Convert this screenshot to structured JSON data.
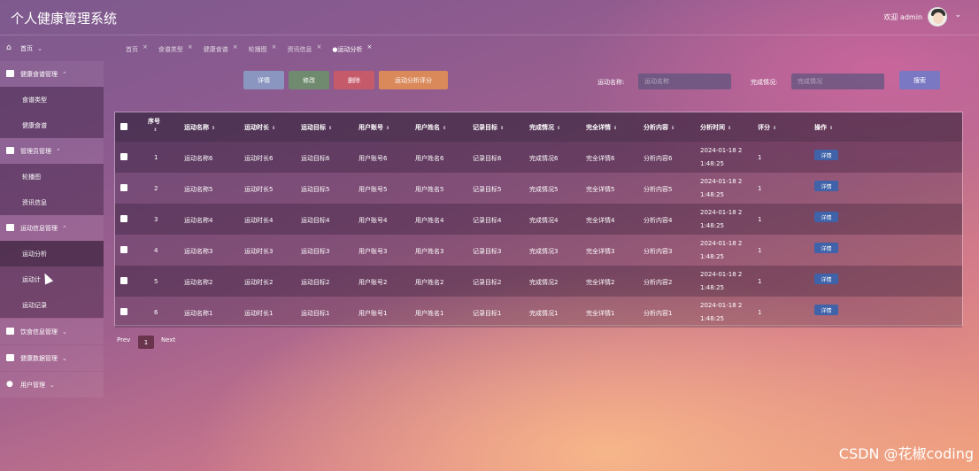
{
  "header": {
    "title": "个人健康管理系统",
    "welcome": "欢迎 admin"
  },
  "sidebar": {
    "home": "首页",
    "group1": "健康食谱管理",
    "sub1": [
      "食谱类型",
      "健康食谱"
    ],
    "group2": "管理员管理",
    "sub2": [
      "轮播图",
      "资讯信息"
    ],
    "group3": "运动信息管理",
    "sub3": [
      "运动分析",
      "运动计",
      "运动记录"
    ],
    "group4": "饮食信息管理",
    "group5": "健康数据管理",
    "group6": "用户管理"
  },
  "tabs": [
    "首页",
    "食谱类型",
    "健康食谱",
    "轮播图",
    "资讯信息",
    "●运动分析"
  ],
  "toolbar": {
    "detail": "详情",
    "edit": "修改",
    "delete": "删除",
    "score": "运动分析评分",
    "name_label": "运动名称:",
    "name_placeholder": "运动名称",
    "status_label": "完成情况:",
    "status_placeholder": "完成情况",
    "search": "搜索"
  },
  "table": {
    "headers": [
      "序号",
      "运动名称",
      "运动时长",
      "运动目标",
      "用户账号",
      "用户姓名",
      "记录目标",
      "完成情况",
      "完全详情",
      "分析内容",
      "分析时间",
      "评分",
      "操作"
    ],
    "rows": [
      [
        "1",
        "运动名称6",
        "运动时长6",
        "运动目标6",
        "用户账号6",
        "用户姓名6",
        "记录目标6",
        "完成情况6",
        "完全详情6",
        "分析内容6",
        "2024-01-18 2",
        "1:48:25",
        "1",
        "详情"
      ],
      [
        "2",
        "运动名称5",
        "运动时长5",
        "运动目标5",
        "用户账号5",
        "用户姓名5",
        "记录目标5",
        "完成情况5",
        "完全详情5",
        "分析内容5",
        "2024-01-18 2",
        "1:48:25",
        "1",
        "详情"
      ],
      [
        "3",
        "运动名称4",
        "运动时长4",
        "运动目标4",
        "用户账号4",
        "用户姓名4",
        "记录目标4",
        "完成情况4",
        "完全详情4",
        "分析内容4",
        "2024-01-18 2",
        "1:48:25",
        "1",
        "详情"
      ],
      [
        "4",
        "运动名称3",
        "运动时长3",
        "运动目标3",
        "用户账号3",
        "用户姓名3",
        "记录目标3",
        "完成情况3",
        "完全详情3",
        "分析内容3",
        "2024-01-18 2",
        "1:48:25",
        "1",
        "详情"
      ],
      [
        "5",
        "运动名称2",
        "运动时长2",
        "运动目标2",
        "用户账号2",
        "用户姓名2",
        "记录目标2",
        "完成情况2",
        "完全详情2",
        "分析内容2",
        "2024-01-18 2",
        "1:48:25",
        "1",
        "详情"
      ],
      [
        "6",
        "运动名称1",
        "运动时长1",
        "运动目标1",
        "用户账号1",
        "用户姓名1",
        "记录目标1",
        "完成情况1",
        "完全详情1",
        "分析内容1",
        "2024-01-18 2",
        "1:48:25",
        "1",
        "详情"
      ]
    ]
  },
  "pagination": {
    "prev": "Prev",
    "page": "1",
    "next": "Next"
  },
  "watermark": "CSDN @花椒coding",
  "colors": {
    "detail_btn": "#8a96c0",
    "edit_btn": "#6f8a6e",
    "delete_btn": "#c55a6a",
    "score_btn": "#d9895a",
    "search_btn": "#7a78c2",
    "row_detail_btn": "#3f62a8"
  }
}
